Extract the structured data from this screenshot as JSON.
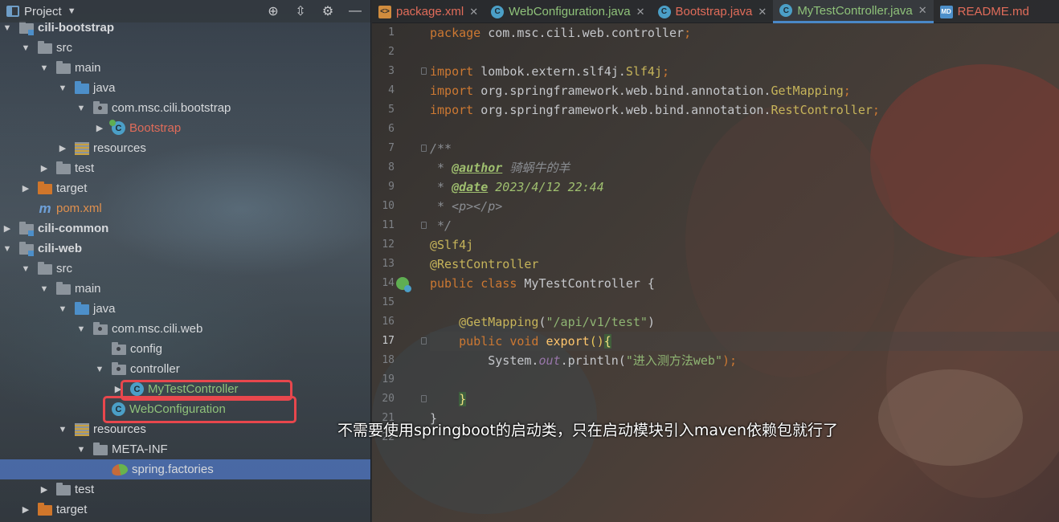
{
  "project_panel": {
    "title": "Project",
    "tree": [
      {
        "label": "cili-bootstrap",
        "indent": 1,
        "arrow": "▼",
        "icon": "module",
        "style": "bold",
        "name": "tree-item-cili-bootstrap"
      },
      {
        "label": "src",
        "indent": 2,
        "arrow": "▼",
        "icon": "folder",
        "style": "",
        "name": "tree-item-src"
      },
      {
        "label": "main",
        "indent": 3,
        "arrow": "▼",
        "icon": "folder",
        "style": "",
        "name": "tree-item-main"
      },
      {
        "label": "java",
        "indent": 4,
        "arrow": "▼",
        "icon": "folder-blue",
        "style": "",
        "name": "tree-item-java"
      },
      {
        "label": "com.msc.cili.bootstrap",
        "indent": 5,
        "arrow": "▼",
        "icon": "package",
        "style": "",
        "name": "tree-item-package-bootstrap"
      },
      {
        "label": "Bootstrap",
        "indent": 6,
        "arrow": "▶",
        "icon": "class-boot",
        "style": "red",
        "name": "tree-item-bootstrap-class"
      },
      {
        "label": "resources",
        "indent": 4,
        "arrow": "▶",
        "icon": "resources",
        "style": "",
        "name": "tree-item-resources"
      },
      {
        "label": "test",
        "indent": 3,
        "arrow": "▶",
        "icon": "folder",
        "style": "",
        "name": "tree-item-test"
      },
      {
        "label": "target",
        "indent": 2,
        "arrow": "▶",
        "icon": "folder-orange",
        "style": "",
        "name": "tree-item-target"
      },
      {
        "label": "pom.xml",
        "indent": 2,
        "arrow": "",
        "icon": "maven",
        "style": "orange",
        "name": "tree-item-pom-xml"
      },
      {
        "label": "cili-common",
        "indent": 1,
        "arrow": "▶",
        "icon": "module",
        "style": "bold",
        "name": "tree-item-cili-common"
      },
      {
        "label": "cili-web",
        "indent": 1,
        "arrow": "▼",
        "icon": "module",
        "style": "bold",
        "name": "tree-item-cili-web"
      },
      {
        "label": "src",
        "indent": 2,
        "arrow": "▼",
        "icon": "folder",
        "style": "",
        "name": "tree-item-src"
      },
      {
        "label": "main",
        "indent": 3,
        "arrow": "▼",
        "icon": "folder",
        "style": "",
        "name": "tree-item-main"
      },
      {
        "label": "java",
        "indent": 4,
        "arrow": "▼",
        "icon": "folder-blue",
        "style": "",
        "name": "tree-item-java"
      },
      {
        "label": "com.msc.cili.web",
        "indent": 5,
        "arrow": "▼",
        "icon": "package",
        "style": "",
        "name": "tree-item-package-web"
      },
      {
        "label": "config",
        "indent": 6,
        "arrow": "",
        "icon": "package",
        "style": "",
        "name": "tree-item-config"
      },
      {
        "label": "controller",
        "indent": 6,
        "arrow": "▼",
        "icon": "package",
        "style": "",
        "name": "tree-item-controller"
      },
      {
        "label": "MyTestController",
        "indent": 7,
        "arrow": "▶",
        "icon": "class",
        "style": "green",
        "name": "tree-item-mytestcontroller"
      },
      {
        "label": "WebConfiguration",
        "indent": 6,
        "arrow": "",
        "icon": "class",
        "style": "green",
        "name": "tree-item-webconfiguration"
      },
      {
        "label": "resources",
        "indent": 4,
        "arrow": "▼",
        "icon": "resources",
        "style": "",
        "name": "tree-item-resources"
      },
      {
        "label": "META-INF",
        "indent": 5,
        "arrow": "▼",
        "icon": "folder",
        "style": "",
        "name": "tree-item-meta-inf"
      },
      {
        "label": "spring.factories",
        "indent": 6,
        "arrow": "",
        "icon": "spring",
        "style": "",
        "selected": true,
        "name": "tree-item-spring-factories"
      },
      {
        "label": "test",
        "indent": 3,
        "arrow": "▶",
        "icon": "folder",
        "style": "",
        "name": "tree-item-test"
      },
      {
        "label": "target",
        "indent": 2,
        "arrow": "▶",
        "icon": "folder-orange",
        "style": "",
        "name": "tree-item-target"
      }
    ]
  },
  "tabs": [
    {
      "label": "package.xml",
      "icon": "xml",
      "style": "red",
      "active": false
    },
    {
      "label": "WebConfiguration.java",
      "icon": "java",
      "style": "green",
      "active": false
    },
    {
      "label": "Bootstrap.java",
      "icon": "java",
      "style": "red",
      "active": false
    },
    {
      "label": "MyTestController.java",
      "icon": "java",
      "style": "green",
      "active": true
    },
    {
      "label": "README.md",
      "icon": "md",
      "style": "red",
      "active": false
    }
  ],
  "editor": {
    "line_numbers": [
      "1",
      "2",
      "3",
      "4",
      "5",
      "6",
      "7",
      "8",
      "9",
      "10",
      "11",
      "12",
      "13",
      "14",
      "15",
      "16",
      "17",
      "18",
      "19",
      "20",
      "21",
      "22"
    ],
    "current_line": 17,
    "lines": [
      [
        {
          "t": "package ",
          "c": "kw"
        },
        {
          "t": "com.msc.cili.web.controller",
          "c": ""
        },
        {
          "t": ";",
          "c": "kw"
        }
      ],
      [],
      [
        {
          "t": "import ",
          "c": "kw"
        },
        {
          "t": "lombok.extern.slf4j.",
          "c": ""
        },
        {
          "t": "Slf4j",
          "c": "ann"
        },
        {
          "t": ";",
          "c": "kw"
        }
      ],
      [
        {
          "t": "import ",
          "c": "kw"
        },
        {
          "t": "org.springframework.web.bind.annotation.",
          "c": ""
        },
        {
          "t": "GetMapping",
          "c": "ann"
        },
        {
          "t": ";",
          "c": "kw"
        }
      ],
      [
        {
          "t": "import ",
          "c": "kw"
        },
        {
          "t": "org.springframework.web.bind.annotation.",
          "c": ""
        },
        {
          "t": "RestController",
          "c": "ann"
        },
        {
          "t": ";",
          "c": "kw"
        }
      ],
      [],
      [
        {
          "t": "/**",
          "c": "cmt"
        }
      ],
      [
        {
          "t": " * ",
          "c": "cmt"
        },
        {
          "t": "@author",
          "c": "tag"
        },
        {
          "t": " 骑蜗牛的羊",
          "c": "cmt"
        }
      ],
      [
        {
          "t": " * ",
          "c": "cmt"
        },
        {
          "t": "@date",
          "c": "tag"
        },
        {
          "t": " 2023/4/12 22:44",
          "c": "tagv"
        }
      ],
      [
        {
          "t": " * ",
          "c": "cmt"
        },
        {
          "t": "<p></p>",
          "c": "cmt"
        }
      ],
      [
        {
          "t": " */",
          "c": "cmt"
        }
      ],
      [
        {
          "t": "@Slf4j",
          "c": "ann"
        }
      ],
      [
        {
          "t": "@RestController",
          "c": "ann"
        }
      ],
      [
        {
          "t": "public class ",
          "c": "kw"
        },
        {
          "t": "MyTestController {",
          "c": ""
        }
      ],
      [],
      [
        {
          "t": "    ",
          "c": ""
        },
        {
          "t": "@GetMapping",
          "c": "ann"
        },
        {
          "t": "(",
          "c": ""
        },
        {
          "t": "\"/api/v1/test\"",
          "c": "str"
        },
        {
          "t": ")",
          "c": ""
        }
      ],
      [
        {
          "t": "    ",
          "c": ""
        },
        {
          "t": "public void ",
          "c": "kw"
        },
        {
          "t": "export",
          "c": "fn"
        },
        {
          "t": "()",
          "c": "brace"
        },
        {
          "t": "{",
          "c": "brace-hl"
        }
      ],
      [
        {
          "t": "        System.",
          "c": ""
        },
        {
          "t": "out",
          "c": "it"
        },
        {
          "t": ".println(",
          "c": ""
        },
        {
          "t": "\"进入测方法web\"",
          "c": "str"
        },
        {
          "t": ");",
          "c": "kw"
        }
      ],
      [],
      [
        {
          "t": "    ",
          "c": ""
        },
        {
          "t": "}",
          "c": "brace-hl"
        }
      ],
      [
        {
          "t": "}",
          "c": ""
        }
      ],
      []
    ]
  },
  "caption": "不需要使用springboot的启动类，只在启动模块引入maven依赖包就行了",
  "colors": {
    "highlight_box": "#e8474d",
    "selection": "#4b6eaf",
    "keyword": "#cc7832",
    "string": "#8fb573",
    "annotation": "#c6b45a"
  }
}
